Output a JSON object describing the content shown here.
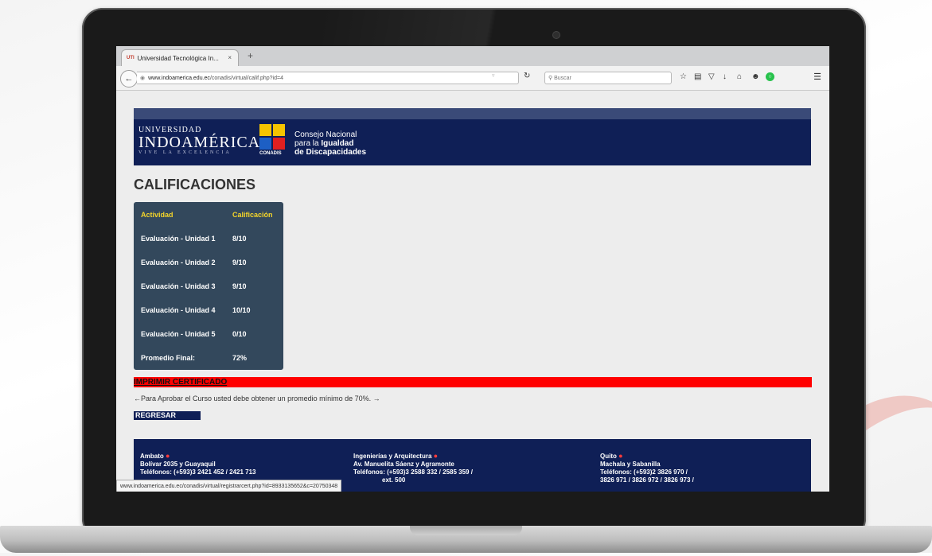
{
  "browser": {
    "tab_title": "Universidad Tecnológica In...",
    "tab_logo": "UTI",
    "tab_close": "×",
    "new_tab": "+",
    "url_domain": "www.indoamerica.edu.ec",
    "url_path": "/conadis/virtual/calif.php?id=4",
    "search_placeholder": "Buscar",
    "status_url": "www.indoamerica.edu.ec/conadis/virtual/registrarcert.php?id=8933135652&c=20750348"
  },
  "banner": {
    "uni_top": "UNIVERSIDAD",
    "uni_main": "INDOAMÉRICA",
    "uni_sub": "VIVE LA EXCELENCIA",
    "conadis_label": "CONADIS",
    "conadis_line1": "Consejo Nacional",
    "conadis_line2_a": "para la ",
    "conadis_line2_b": "Igualdad",
    "conadis_line3": "de Discapacidades"
  },
  "page": {
    "heading": "CALIFICACIONES",
    "col_activity": "Actividad",
    "col_grade": "Calificación",
    "rows": [
      {
        "activity": "Evaluación - Unidad 1",
        "grade": "8/10"
      },
      {
        "activity": "Evaluación - Unidad 2",
        "grade": "9/10"
      },
      {
        "activity": "Evaluación - Unidad 3",
        "grade": "9/10"
      },
      {
        "activity": "Evaluación - Unidad 4",
        "grade": "10/10"
      },
      {
        "activity": "Evaluación - Unidad 5",
        "grade": "0/10"
      },
      {
        "activity": "Promedio Final:",
        "grade": "72%"
      }
    ],
    "print_link": "IMPRIMIR CERTIFICADO",
    "note": "←Para Aprobar el Curso usted debe obtener un promedio mínimo de 70%. →",
    "back_link": "REGRESAR"
  },
  "footer": {
    "ambato_title": "Ambato",
    "ambato_addr": "Bolívar 2035 y Guayaquil",
    "ambato_phone": "Teléfonos: (+593)3 2421 452 / 2421 713",
    "ing_title": "Ingenierías y Arquitectura",
    "ing_addr": "Av. Manuelita Sáenz y Agramonte",
    "ing_phone": "Teléfonos: (+593)3 2588 332 / 2585 359 /",
    "ing_ext": "ext. 500",
    "quito_title": "Quito",
    "quito_addr": "Machala y Sabanilla",
    "quito_phone1": "Teléfonos: (+593)2 3826 970 /",
    "quito_phone2": "3826 971 / 3826 972 / 3826 973 /"
  }
}
